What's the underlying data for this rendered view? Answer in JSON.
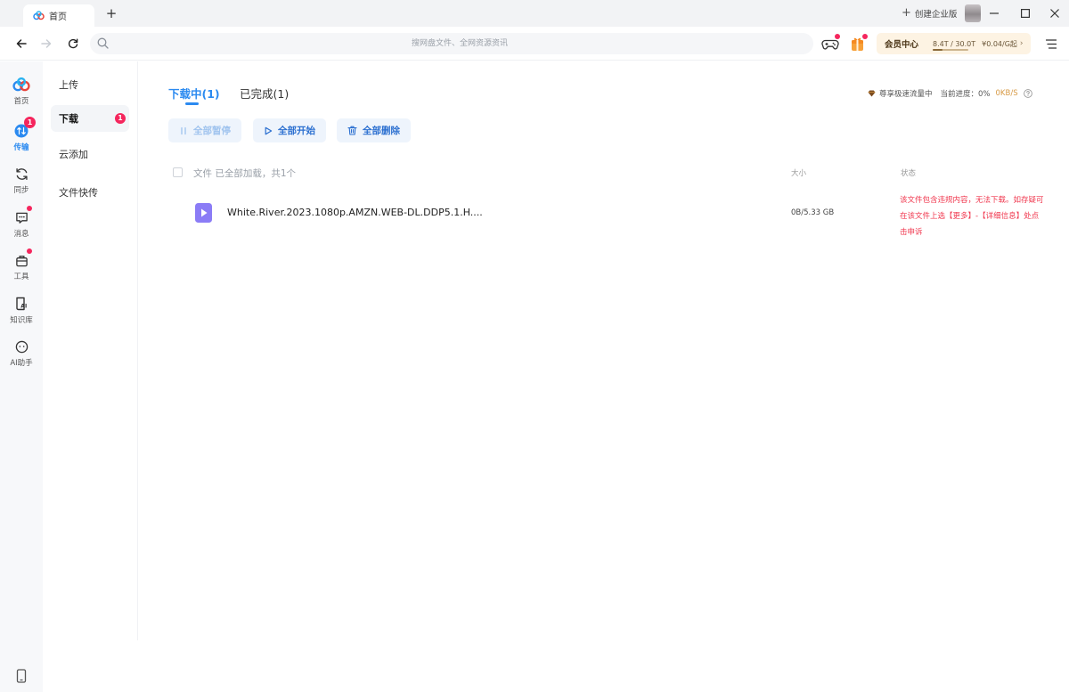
{
  "titlebar": {
    "tab_label": "首页",
    "new_tab": "+",
    "enterprise_label": "创建企业版"
  },
  "navbar": {
    "search_placeholder": "搜网盘文件、全网资源资讯",
    "vip": {
      "label": "会员中心",
      "storage": "8.4T / 30.0T",
      "storage_used_fraction": 0.28,
      "price": "¥0.04/G起",
      "arrow": "›"
    }
  },
  "rail": {
    "items": [
      {
        "label": "首页",
        "icon": "baidu-cloud-logo-icon"
      },
      {
        "label": "传输",
        "icon": "transfer-icon",
        "badge": "1",
        "active": true
      },
      {
        "label": "同步",
        "icon": "sync-icon"
      },
      {
        "label": "消息",
        "icon": "message-icon",
        "dot": true
      },
      {
        "label": "工具",
        "icon": "toolbox-icon",
        "dot": true
      },
      {
        "label": "知识库",
        "icon": "knowledge-base-icon"
      },
      {
        "label": "AI助手",
        "icon": "ai-assistant-icon"
      }
    ]
  },
  "sub_nav": {
    "items": [
      {
        "label": "上传"
      },
      {
        "label": "下载",
        "badge": "1",
        "active": true
      },
      {
        "label": "云添加"
      },
      {
        "label": "文件快传"
      }
    ]
  },
  "main": {
    "tabs": [
      {
        "label": "下载中(1)",
        "active": true
      },
      {
        "label": "已完成(1)"
      }
    ],
    "speed_info": {
      "accel_label": "尊享极速流量中",
      "progress_label": "当前进度：0%",
      "speed": "0KB/S"
    },
    "actions": {
      "pause_all": "全部暂停",
      "start_all": "全部开始",
      "delete_all": "全部删除"
    },
    "table": {
      "col_file": "文件 已全部加载，共1个",
      "col_size": "大小",
      "col_status": "状态",
      "rows": [
        {
          "name": "White.River.2023.1080p.AMZN.WEB-DL.DDP5.1.H....",
          "size": "0B/5.33 GB",
          "status": "该文件包含违规内容，无法下载。如存疑可在该文件上选【更多】-【详细信息】处点击申诉"
        }
      ]
    }
  },
  "colors": {
    "accent": "#2b8af0",
    "badge": "#f5265d",
    "error": "#f0384f",
    "vip_bg": "#fdf3e3",
    "speed": "#d79a45"
  }
}
